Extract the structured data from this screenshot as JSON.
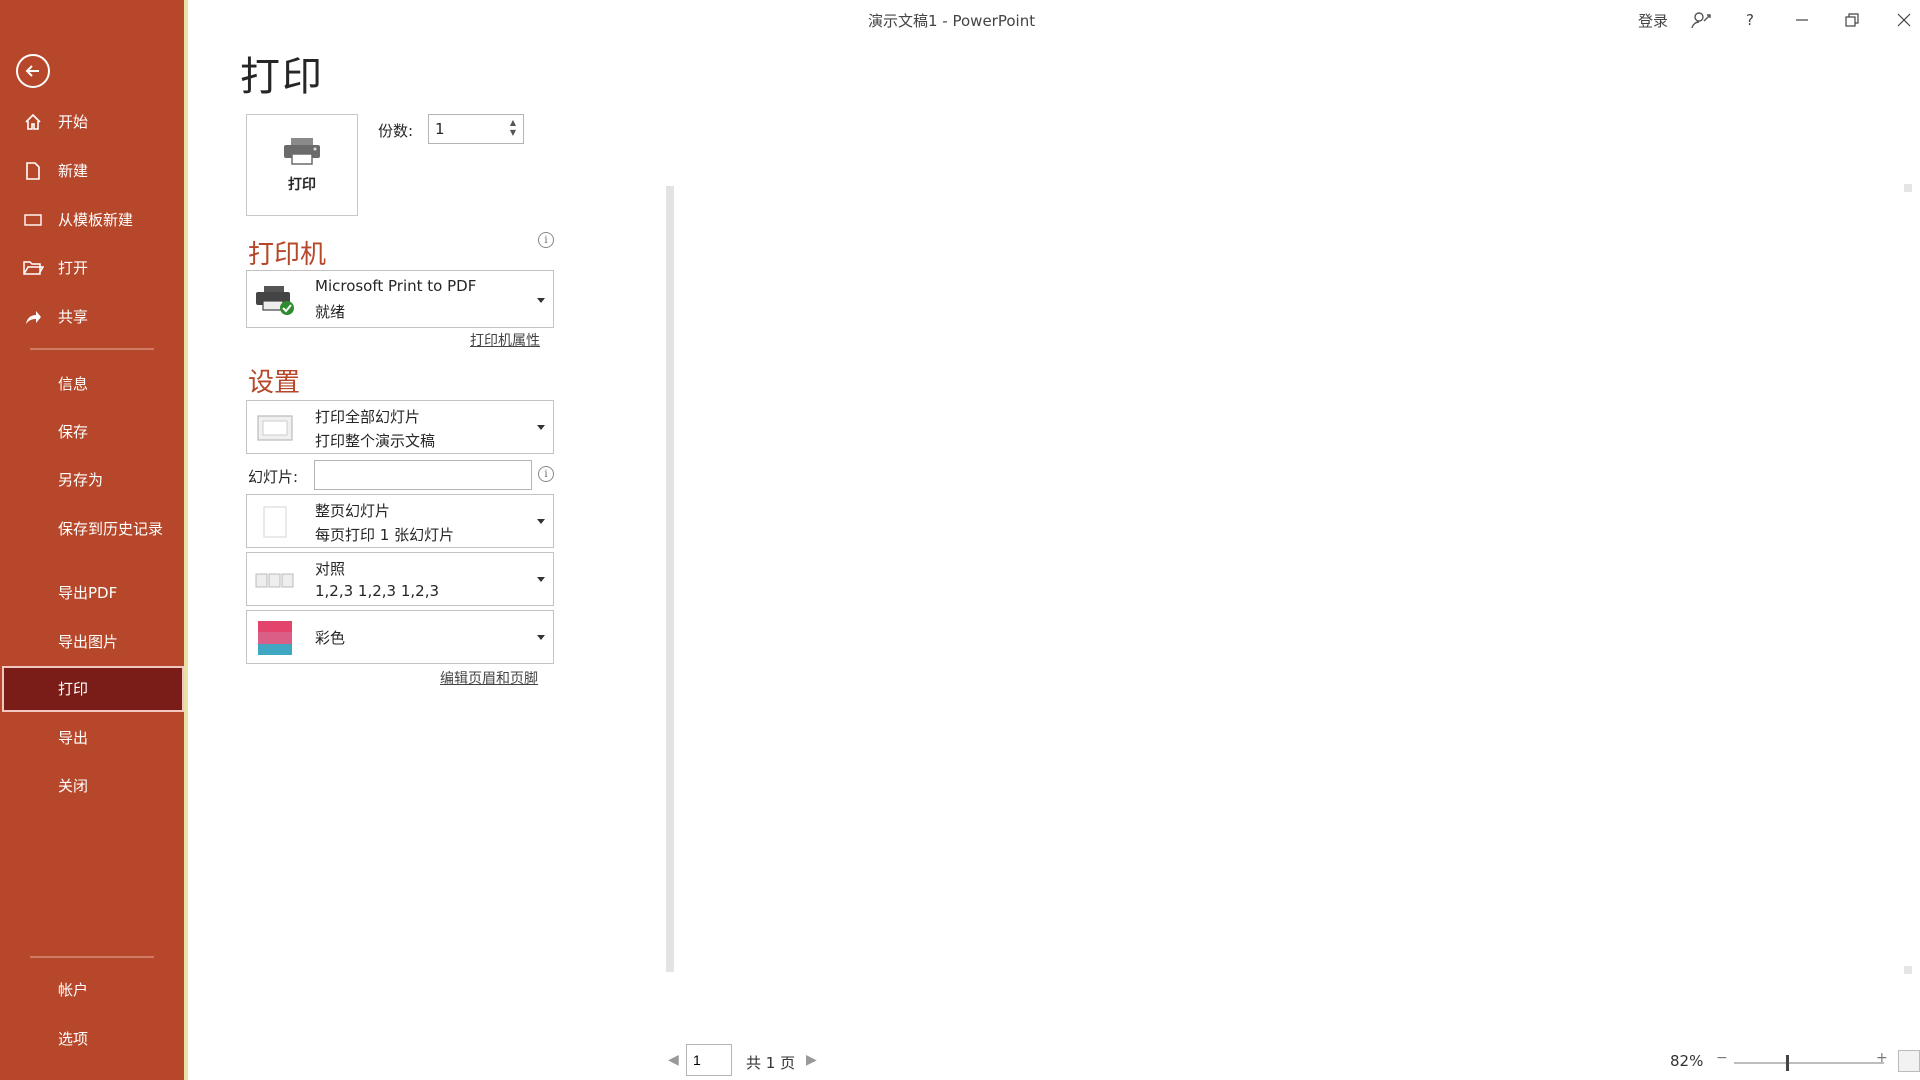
{
  "window": {
    "doc_title": "演示文稿1 - PowerPoint",
    "sign_in": "登录",
    "help": "?"
  },
  "sidebar": {
    "items": [
      {
        "label": "开始"
      },
      {
        "label": "新建"
      },
      {
        "label": "从模板新建"
      },
      {
        "label": "打开"
      },
      {
        "label": "共享"
      },
      {
        "label": "信息"
      },
      {
        "label": "保存"
      },
      {
        "label": "另存为"
      },
      {
        "label": "保存到历史记录"
      },
      {
        "label": "导出PDF"
      },
      {
        "label": "导出图片"
      },
      {
        "label": "打印"
      },
      {
        "label": "导出"
      },
      {
        "label": "关闭"
      },
      {
        "label": "帐户"
      },
      {
        "label": "选项"
      }
    ]
  },
  "print": {
    "heading": "打印",
    "button_label": "打印",
    "copies_label": "份数:",
    "copies_value": "1",
    "printer_heading": "打印机",
    "printer_name": "Microsoft Print to PDF",
    "printer_status": "就绪",
    "printer_properties": "打印机属性",
    "settings_heading": "设置",
    "range_title": "打印全部幻灯片",
    "range_sub": "打印整个演示文稿",
    "slides_label": "幻灯片:",
    "slides_value": "",
    "layout_title": "整页幻灯片",
    "layout_sub": "每页打印 1 张幻灯片",
    "collate_title": "对照",
    "collate_sub": "1,2,3    1,2,3    1,2,3",
    "color_title": "彩色",
    "edit_header_footer": "编辑页眉和页脚"
  },
  "footer": {
    "page_value": "1",
    "page_total": "共 1 页",
    "zoom": "82%",
    "zoom_level_percent": 82
  },
  "colors": {
    "sidebar_bg": "#b7472a",
    "sidebar_active": "#7a1c17",
    "accent": "#b7472a"
  }
}
